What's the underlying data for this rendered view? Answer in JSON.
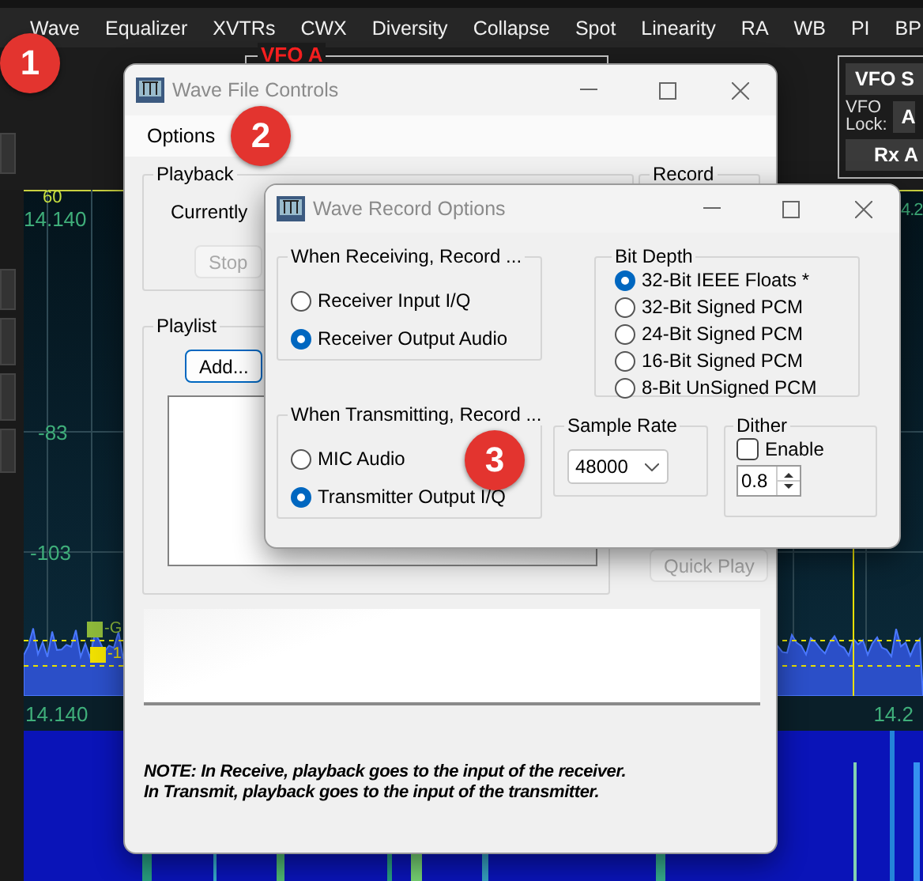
{
  "app": {
    "menu": [
      "Wave",
      "Equalizer",
      "XVTRs",
      "CWX",
      "Diversity",
      "Collapse",
      "Spot",
      "Linearity",
      "RA",
      "WB",
      "PI",
      "BP"
    ],
    "vfo_a_label": "VFO A",
    "right_panel": {
      "sync_button": "VFO S",
      "lock_label": [
        "VFO",
        "Lock:"
      ],
      "lock_button": "A",
      "rx_button": "Rx A"
    },
    "spectrum": {
      "top_marker": "60",
      "top_left_freq": "14.140",
      "top_right_freq": "4.2",
      "levels": [
        "-83",
        "-103"
      ],
      "markers": [
        {
          "label": "-G",
          "color": "#8db83a"
        },
        {
          "label": "-1",
          "color": "#f0e000"
        }
      ],
      "bottom_left_freq": "14.140",
      "bottom_right_freq": "14.2"
    }
  },
  "badges": [
    "1",
    "2",
    "3"
  ],
  "wave_file_controls": {
    "title": "Wave File Controls",
    "menu": [
      "Options"
    ],
    "playback": {
      "title": "Playback",
      "status": "Currently",
      "stop_button": {
        "label": "Stop",
        "disabled": true
      }
    },
    "record": {
      "title": "Record"
    },
    "playlist": {
      "title": "Playlist",
      "add_button": {
        "label": "Add...",
        "disabled": false
      }
    },
    "quick_play_button": {
      "label": "Quick Play",
      "disabled": true
    },
    "note": [
      "NOTE: In Receive, playback goes to the input of the receiver.",
      "In Transmit, playback goes to the input of the transmitter."
    ]
  },
  "wave_record_options": {
    "title": "Wave Record Options",
    "receiving": {
      "title": "When Receiving, Record ...",
      "options": [
        {
          "label": "Receiver Input I/Q",
          "selected": false
        },
        {
          "label": "Receiver Output Audio",
          "selected": true
        }
      ]
    },
    "transmitting": {
      "title": "When Transmitting, Record ...",
      "options": [
        {
          "label": "MIC Audio",
          "selected": false
        },
        {
          "label": "Transmitter Output I/Q",
          "selected": true
        }
      ]
    },
    "bit_depth": {
      "title": "Bit Depth",
      "options": [
        {
          "label": "32-Bit IEEE Floats *",
          "selected": true
        },
        {
          "label": "32-Bit Signed PCM",
          "selected": false
        },
        {
          "label": "24-Bit Signed PCM",
          "selected": false
        },
        {
          "label": "16-Bit Signed PCM",
          "selected": false
        },
        {
          "label": "8-Bit UnSigned PCM",
          "selected": false
        }
      ]
    },
    "sample_rate": {
      "title": "Sample Rate",
      "value": "48000"
    },
    "dither": {
      "title": "Dither",
      "enable": {
        "label": "Enable",
        "checked": false
      },
      "value": "0.8"
    }
  }
}
